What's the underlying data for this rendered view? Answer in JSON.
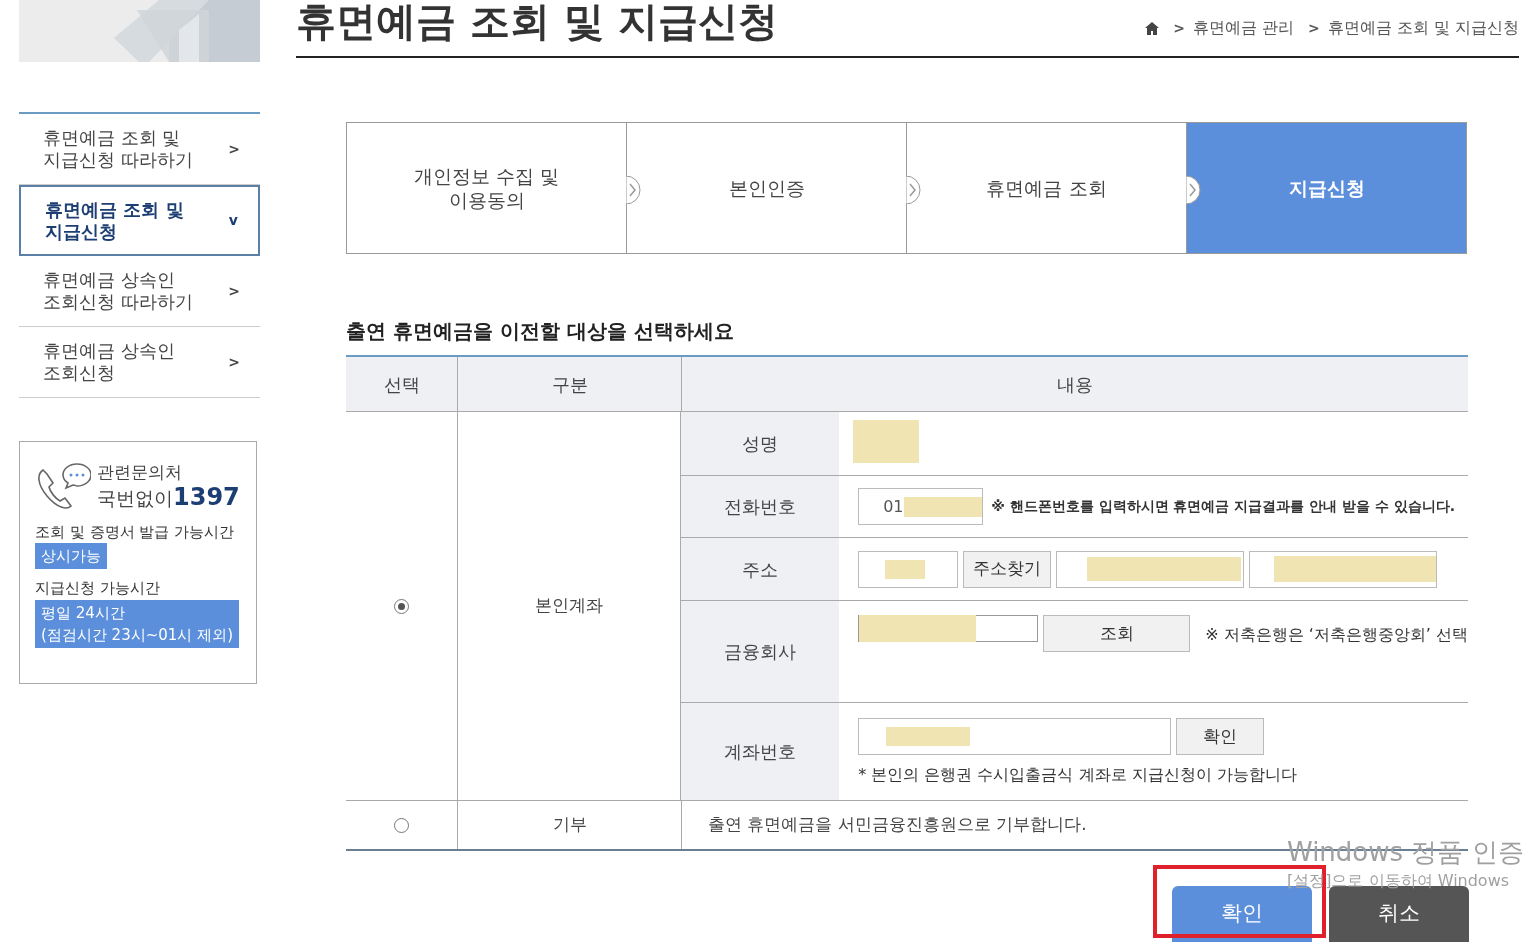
{
  "page_title": "휴면예금 조회 및 지급신청",
  "breadcrumb": [
    {
      "separator": ">",
      "label": "휴면예금 관리"
    },
    {
      "separator": ">",
      "label": "휴면예금 조회 및 지급신청"
    }
  ],
  "sidebar": {
    "items": [
      {
        "label": "휴면예금 조회 및\n지급신청 따라하기",
        "selected": false,
        "chevron": ">"
      },
      {
        "label": "휴면예금 조회 및\n지급신청",
        "selected": true,
        "chevron": "v"
      },
      {
        "label": "휴면예금 상속인\n조회신청 따라하기",
        "selected": false,
        "chevron": ">"
      },
      {
        "label": "휴면예금 상속인\n조회신청",
        "selected": false,
        "chevron": ">"
      }
    ]
  },
  "contact": {
    "title": "관련문의처",
    "prefix": "국번없이",
    "number": "1397",
    "hours": [
      {
        "label": "조회 및 증명서 발급 가능시간",
        "badge": [
          "상시가능"
        ]
      },
      {
        "label": "지급신청 가능시간",
        "badge": [
          "평일 24시간",
          "(점검시간 23시~01시 제외)"
        ]
      }
    ]
  },
  "steps": [
    {
      "label": "개인정보 수집 및\n이용동의",
      "selected": false
    },
    {
      "label": "본인인증",
      "selected": false
    },
    {
      "label": "휴면예금 조회",
      "selected": false
    },
    {
      "label": "지급신청",
      "selected": true
    }
  ],
  "section_heading": "출연 휴면예금을 이전할 대상을 선택하세요",
  "table": {
    "columns": [
      "선택",
      "구분",
      "내용"
    ],
    "rows": [
      {
        "selected": true,
        "category": "본인계좌",
        "fields": [
          {
            "kind": "name",
            "label": "성명"
          },
          {
            "kind": "phone",
            "label": "전화번호",
            "value": "01",
            "note": "※ 핸드폰번호를 입력하시면 휴면예금 지급결과를 안내 받을 수 있습니다."
          },
          {
            "kind": "address",
            "label": "주소",
            "button": "주소찾기"
          },
          {
            "kind": "bank",
            "label": "금융회사",
            "button": "조회",
            "note": "※ 저축은행은 ‘저축은행중앙회’ 선택"
          },
          {
            "kind": "account",
            "label": "계좌번호",
            "button": "확인",
            "note": "* 본인의 은행권 수시입출금식 계좌로 지급신청이 가능합니다"
          }
        ]
      },
      {
        "selected": false,
        "category": "기부",
        "text": "출연 휴면예금을 서민금융진흥원으로 기부합니다."
      }
    ]
  },
  "buttons": [
    {
      "kind": "primary",
      "label": "확인",
      "highlighted": true
    },
    {
      "kind": "secondary",
      "label": "취소",
      "highlighted": false
    }
  ],
  "os_notice": {
    "title": "Windows 정품 인증",
    "subtitle": "[설정]으로 이동하여 Windows"
  }
}
